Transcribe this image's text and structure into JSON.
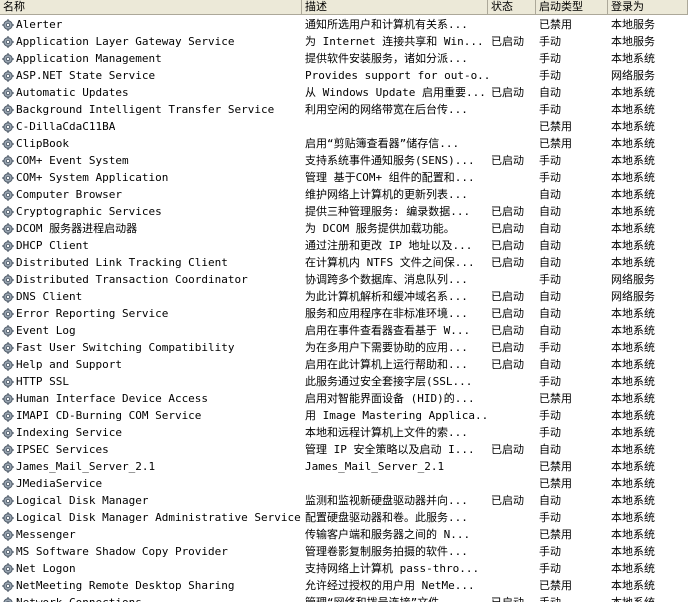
{
  "columns": {
    "name": "名称",
    "desc": "描述",
    "status": "状态",
    "startup": "启动类型",
    "logon": "登录为"
  },
  "rows": [
    {
      "name": "Alerter",
      "desc": "通知所选用户和计算机有关系...",
      "status": "",
      "startup": "已禁用",
      "logon": "本地服务"
    },
    {
      "name": "Application Layer Gateway Service",
      "desc": "为 Internet 连接共享和 Win...",
      "status": "已启动",
      "startup": "手动",
      "logon": "本地服务"
    },
    {
      "name": "Application Management",
      "desc": "提供软件安装服务，诸如分派...",
      "status": "",
      "startup": "手动",
      "logon": "本地系统"
    },
    {
      "name": "ASP.NET State Service",
      "desc": "Provides support for out-o...",
      "status": "",
      "startup": "手动",
      "logon": "网络服务"
    },
    {
      "name": "Automatic Updates",
      "desc": "从 Windows Update 启用重要...",
      "status": "已启动",
      "startup": "自动",
      "logon": "本地系统"
    },
    {
      "name": "Background Intelligent Transfer Service",
      "desc": "利用空闲的网络带宽在后台传...",
      "status": "",
      "startup": "手动",
      "logon": "本地系统"
    },
    {
      "name": "C-DillaCdaC11BA",
      "desc": "",
      "status": "",
      "startup": "已禁用",
      "logon": "本地系统"
    },
    {
      "name": "ClipBook",
      "desc": "启用“剪贴簿查看器”储存信...",
      "status": "",
      "startup": "已禁用",
      "logon": "本地系统"
    },
    {
      "name": "COM+ Event System",
      "desc": "支持系统事件通知服务(SENS)...",
      "status": "已启动",
      "startup": "手动",
      "logon": "本地系统"
    },
    {
      "name": "COM+ System Application",
      "desc": "管理 基于COM+ 组件的配置和...",
      "status": "",
      "startup": "手动",
      "logon": "本地系统"
    },
    {
      "name": "Computer Browser",
      "desc": "维护网络上计算机的更新列表...",
      "status": "",
      "startup": "自动",
      "logon": "本地系统"
    },
    {
      "name": "Cryptographic Services",
      "desc": "提供三种管理服务: 编录数据...",
      "status": "已启动",
      "startup": "自动",
      "logon": "本地系统"
    },
    {
      "name": "DCOM 服务器进程启动器",
      "desc": "为 DCOM 服务提供加载功能。",
      "status": "已启动",
      "startup": "自动",
      "logon": "本地系统"
    },
    {
      "name": "DHCP Client",
      "desc": "通过注册和更改 IP 地址以及...",
      "status": "已启动",
      "startup": "自动",
      "logon": "本地系统"
    },
    {
      "name": "Distributed Link Tracking Client",
      "desc": "在计算机内 NTFS 文件之间保...",
      "status": "已启动",
      "startup": "自动",
      "logon": "本地系统"
    },
    {
      "name": "Distributed Transaction Coordinator",
      "desc": "协调跨多个数据库、消息队列...",
      "status": "",
      "startup": "手动",
      "logon": "网络服务"
    },
    {
      "name": "DNS Client",
      "desc": "为此计算机解析和缓冲域名系...",
      "status": "已启动",
      "startup": "自动",
      "logon": "网络服务"
    },
    {
      "name": "Error Reporting Service",
      "desc": "服务和应用程序在非标准环境...",
      "status": "已启动",
      "startup": "自动",
      "logon": "本地系统"
    },
    {
      "name": "Event Log",
      "desc": "启用在事件查看器查看基于 W...",
      "status": "已启动",
      "startup": "自动",
      "logon": "本地系统"
    },
    {
      "name": "Fast User Switching Compatibility",
      "desc": "为在多用户下需要协助的应用...",
      "status": "已启动",
      "startup": "手动",
      "logon": "本地系统"
    },
    {
      "name": "Help and Support",
      "desc": "启用在此计算机上运行帮助和...",
      "status": "已启动",
      "startup": "自动",
      "logon": "本地系统"
    },
    {
      "name": "HTTP SSL",
      "desc": "此服务通过安全套接字层(SSL...",
      "status": "",
      "startup": "手动",
      "logon": "本地系统"
    },
    {
      "name": "Human Interface Device Access",
      "desc": "启用对智能界面设备 (HID)的...",
      "status": "",
      "startup": "已禁用",
      "logon": "本地系统"
    },
    {
      "name": "IMAPI CD-Burning COM Service",
      "desc": "用 Image Mastering Applica...",
      "status": "",
      "startup": "手动",
      "logon": "本地系统"
    },
    {
      "name": "Indexing Service",
      "desc": "本地和远程计算机上文件的索...",
      "status": "",
      "startup": "手动",
      "logon": "本地系统"
    },
    {
      "name": "IPSEC Services",
      "desc": "管理 IP 安全策略以及启动 I...",
      "status": "已启动",
      "startup": "自动",
      "logon": "本地系统"
    },
    {
      "name": "James_Mail_Server_2.1",
      "desc": "James_Mail_Server_2.1",
      "status": "",
      "startup": "已禁用",
      "logon": "本地系统"
    },
    {
      "name": "JMediaService",
      "desc": "",
      "status": "",
      "startup": "已禁用",
      "logon": "本地系统"
    },
    {
      "name": "Logical Disk Manager",
      "desc": "监测和监视新硬盘驱动器并向...",
      "status": "已启动",
      "startup": "自动",
      "logon": "本地系统"
    },
    {
      "name": "Logical Disk Manager Administrative Service",
      "desc": "配置硬盘驱动器和卷。此服务...",
      "status": "",
      "startup": "手动",
      "logon": "本地系统"
    },
    {
      "name": "Messenger",
      "desc": "传输客户端和服务器之间的 N...",
      "status": "",
      "startup": "已禁用",
      "logon": "本地系统"
    },
    {
      "name": "MS Software Shadow Copy Provider",
      "desc": "管理卷影复制服务拍摄的软件...",
      "status": "",
      "startup": "手动",
      "logon": "本地系统"
    },
    {
      "name": "Net Logon",
      "desc": "支持网络上计算机 pass-thro...",
      "status": "",
      "startup": "手动",
      "logon": "本地系统"
    },
    {
      "name": "NetMeeting Remote Desktop Sharing",
      "desc": "允许经过授权的用户用 NetMe...",
      "status": "",
      "startup": "已禁用",
      "logon": "本地系统"
    },
    {
      "name": "Network Connections",
      "desc": "管理“网络和拨号连接”文件...",
      "status": "已启动",
      "startup": "手动",
      "logon": "本地系统"
    }
  ]
}
